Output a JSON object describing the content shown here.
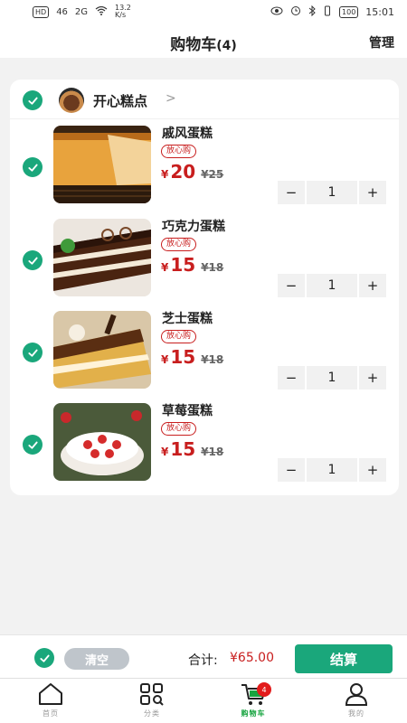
{
  "status_bar": {
    "hd": "HD",
    "net1": "46",
    "net2": "2G",
    "speed": "13.2\nK/s",
    "battery": "100",
    "time": "15:01"
  },
  "header": {
    "title": "购物车",
    "count": "(4)",
    "manage": "管理"
  },
  "shop": {
    "name": "开心糕点",
    "arrow": ">"
  },
  "items": [
    {
      "name": "戚风蛋糕",
      "badge": "放心购",
      "yen": "¥",
      "price": "20",
      "old_price": "¥25",
      "qty": "1"
    },
    {
      "name": "巧克力蛋糕",
      "badge": "放心购",
      "yen": "¥",
      "price": "15",
      "old_price": "¥18",
      "qty": "1"
    },
    {
      "name": "芝士蛋糕",
      "badge": "放心购",
      "yen": "¥",
      "price": "15",
      "old_price": "¥18",
      "qty": "1"
    },
    {
      "name": "草莓蛋糕",
      "badge": "放心购",
      "yen": "¥",
      "price": "15",
      "old_price": "¥18",
      "qty": "1"
    }
  ],
  "stepper": {
    "minus": "−",
    "plus": "+"
  },
  "checkout": {
    "clear": "清空",
    "total_label": "合计:",
    "total_value": "¥65.00",
    "settle": "结算"
  },
  "tabs": [
    {
      "label": "首页",
      "icon": "home-icon"
    },
    {
      "label": "分类",
      "icon": "category-icon"
    },
    {
      "label": "购物车",
      "icon": "cart-icon",
      "badge": "4"
    },
    {
      "label": "我的",
      "icon": "user-icon"
    }
  ],
  "colors": {
    "accent": "#1aa77b",
    "price": "#c81e1e",
    "active_tab": "#16a43f"
  }
}
